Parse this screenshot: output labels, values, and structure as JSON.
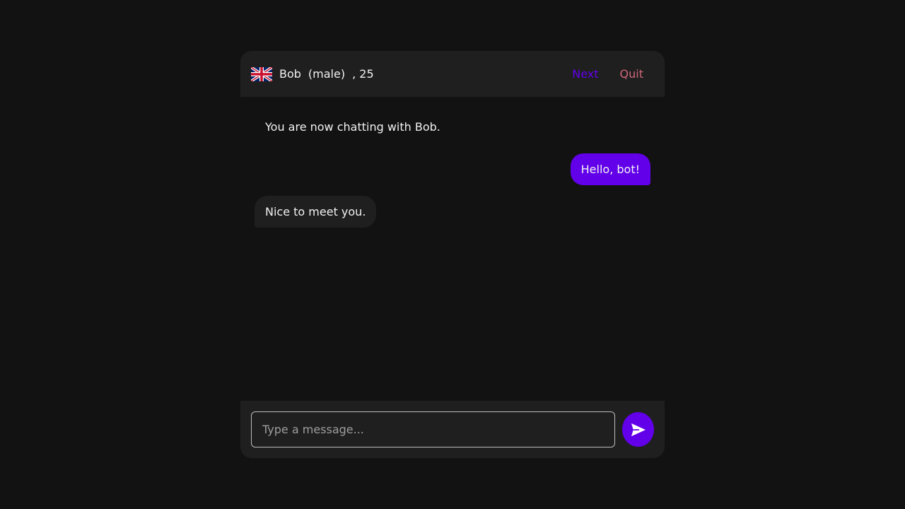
{
  "header": {
    "flag_icon": "uk-flag-icon",
    "user_name": "Bob",
    "user_gender": "(male)",
    "user_age": ", 25",
    "next_label": "Next",
    "quit_label": "Quit"
  },
  "messages": {
    "system_text": "You are now chatting with Bob.",
    "items": [
      {
        "direction": "outgoing",
        "text": "Hello, bot!"
      },
      {
        "direction": "incoming",
        "text": "Nice to meet you."
      }
    ]
  },
  "composer": {
    "placeholder": "Type a message...",
    "value": "",
    "send_icon": "send-icon"
  },
  "colors": {
    "background": "#121212",
    "panel": "#1f1f1f",
    "accent": "#6200ea",
    "quit": "#cf6679",
    "text": "#f2f2f2"
  }
}
